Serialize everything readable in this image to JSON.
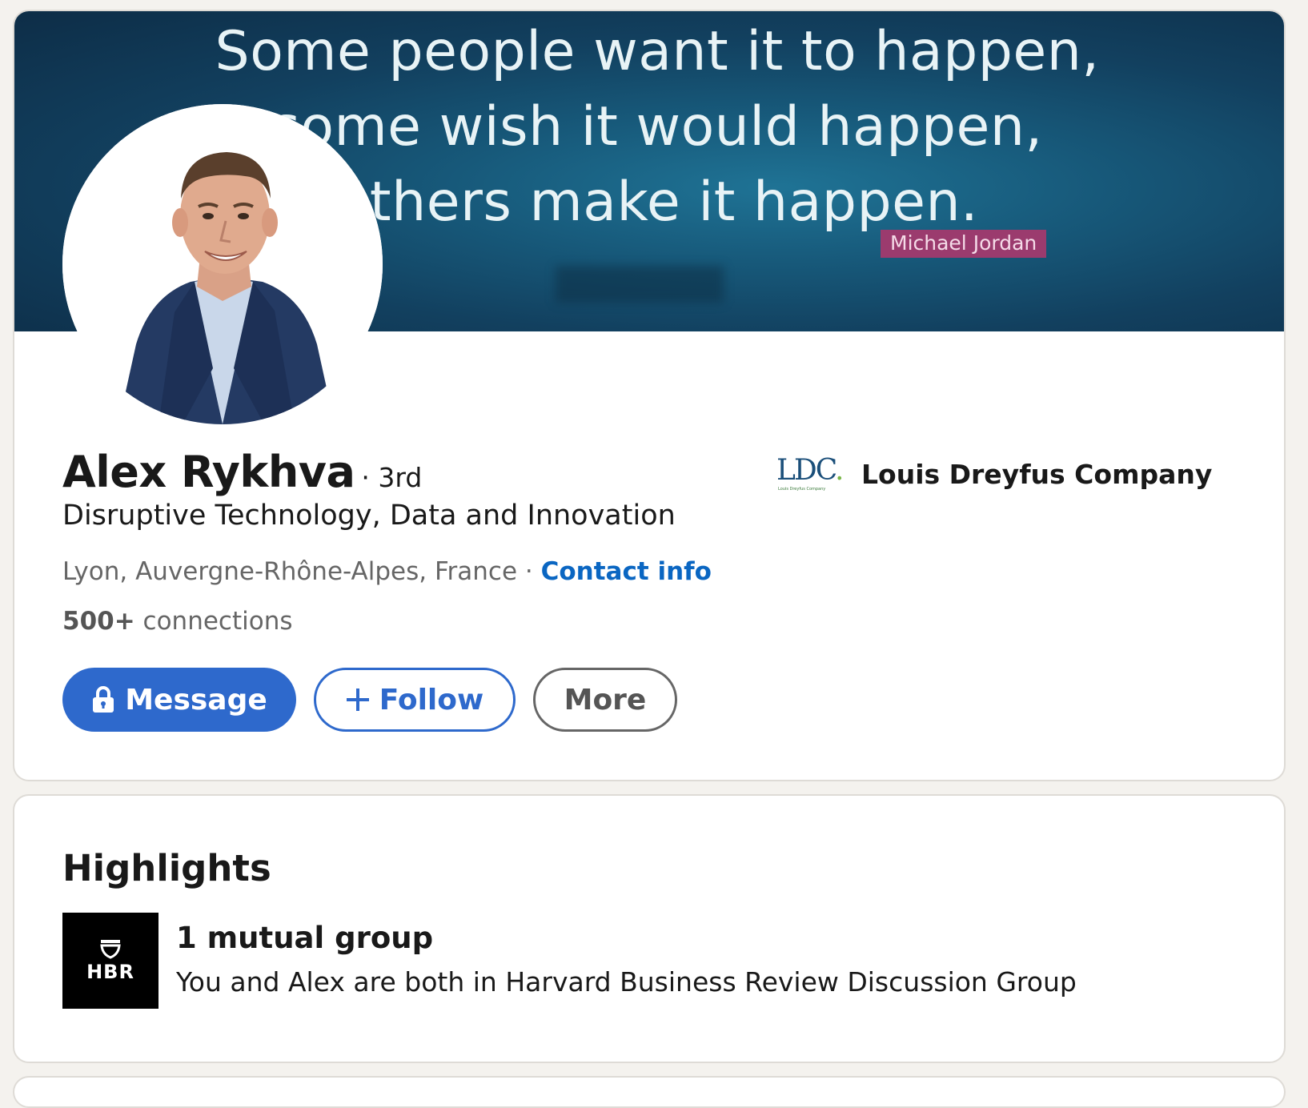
{
  "banner": {
    "quote_line1": "Some people want it to happen,",
    "quote_line2": "some wish it would happen,",
    "quote_line3": "others make it happen.",
    "author": "Michael Jordan"
  },
  "profile": {
    "name": "Alex Rykhva",
    "degree": "· 3rd",
    "headline": "Disruptive Technology, Data and Innovation",
    "location": "Lyon, Auvergne-Rhône-Alpes, France",
    "separator": " · ",
    "contact_label": "Contact info",
    "connections_count": "500+",
    "connections_label": " connections"
  },
  "company": {
    "logo_text": "LDC",
    "logo_dot": ".",
    "logo_subtext": "Louis Dreyfus Company",
    "name": "Louis Dreyfus Company"
  },
  "actions": {
    "message_label": "Message",
    "follow_label": "Follow",
    "more_label": "More"
  },
  "highlights": {
    "title": "Highlights",
    "group_logo_text": "HBR",
    "item_heading": "1 mutual group",
    "item_description": "You and Alex are both in Harvard Business Review Discussion Group"
  },
  "colors": {
    "accent_blue": "#2e69cc",
    "link_blue": "#0a66c2",
    "banner_dark": "#12405f",
    "author_tag": "#9b3b6e"
  }
}
